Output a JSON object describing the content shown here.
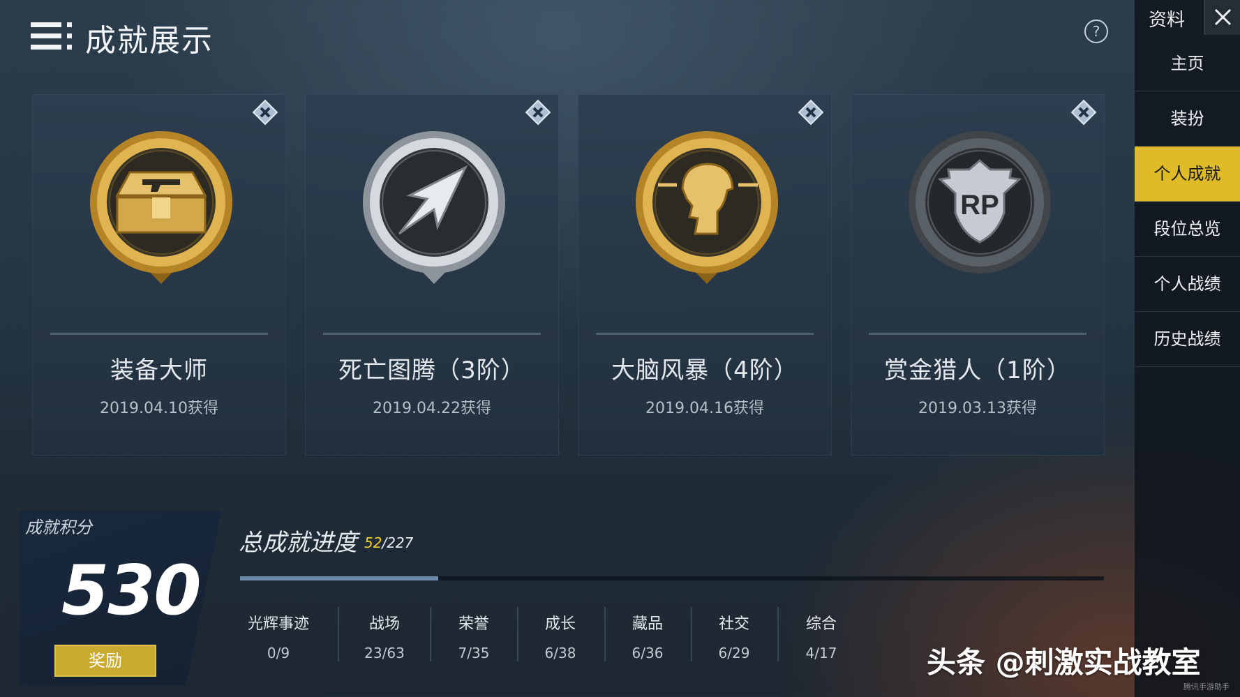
{
  "header": {
    "title": "成就展示",
    "help_icon": "help-circle-icon",
    "menu_icon": "menu-icon"
  },
  "cards": [
    {
      "name": "装备大师",
      "date": "2019.04.10获得",
      "medal_style": "gold",
      "icon": "pistol-crate-icon"
    },
    {
      "name": "死亡图腾（3阶）",
      "date": "2019.04.22获得",
      "medal_style": "silver",
      "icon": "bullet-arrow-icon"
    },
    {
      "name": "大脑风暴（4阶）",
      "date": "2019.04.16获得",
      "medal_style": "gold",
      "icon": "helmet-head-icon"
    },
    {
      "name": "赏金猎人（1阶）",
      "date": "2019.03.13获得",
      "medal_style": "dark",
      "icon": "rp-shield-icon"
    }
  ],
  "score": {
    "label": "成就积分",
    "value": "530",
    "reward_label": "奖励"
  },
  "progress": {
    "title": "总成就进度",
    "current": "52",
    "total": "/227",
    "fraction": 0.229,
    "categories": [
      {
        "name": "光辉事迹",
        "value": "0/9"
      },
      {
        "name": "战场",
        "value": "23/63"
      },
      {
        "name": "荣誉",
        "value": "7/35"
      },
      {
        "name": "成长",
        "value": "6/38"
      },
      {
        "name": "藏品",
        "value": "6/36"
      },
      {
        "name": "社交",
        "value": "6/29"
      },
      {
        "name": "综合",
        "value": "4/17"
      }
    ]
  },
  "sidebar": {
    "title": "资料",
    "items": [
      {
        "label": "主页",
        "active": false
      },
      {
        "label": "装扮",
        "active": false
      },
      {
        "label": "个人成就",
        "active": true
      },
      {
        "label": "段位总览",
        "active": false
      },
      {
        "label": "个人战绩",
        "active": false
      },
      {
        "label": "历史战绩",
        "active": false
      }
    ]
  },
  "watermark": {
    "text": "头条 @刺激实战教室",
    "small": "腾讯手游助手"
  },
  "colors": {
    "accent": "#e0bb28",
    "progress": "#6f8aa8",
    "gold": "#c89a2e",
    "silver": "#c7ccd2"
  }
}
